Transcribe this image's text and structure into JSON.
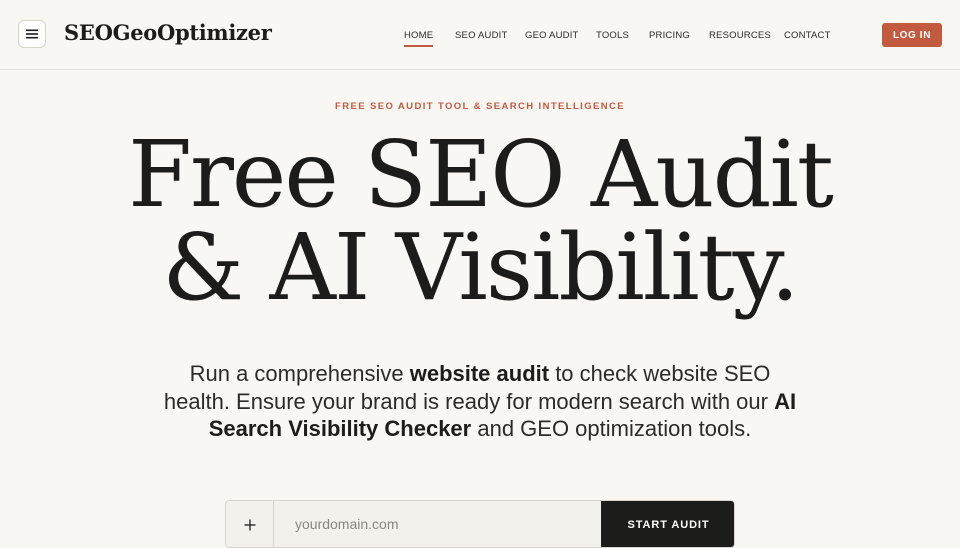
{
  "header": {
    "logo": "SEOGeoOptimizer",
    "menu_icon": "hamburger-menu-icon",
    "nav": [
      {
        "label": "HOME",
        "active": true
      },
      {
        "label": "SEO AUDIT",
        "active": false
      },
      {
        "label": "GEO AUDIT",
        "active": false
      },
      {
        "label": "TOOLS",
        "active": false
      },
      {
        "label": "PRICING",
        "active": false
      },
      {
        "label": "RESOURCES",
        "active": false
      },
      {
        "label": "CONTACT",
        "active": false
      }
    ],
    "login_label": "LOG IN"
  },
  "hero": {
    "eyebrow": "FREE SEO AUDIT TOOL & SEARCH INTELLIGENCE",
    "headline_line1": "Free SEO Audit",
    "headline_line2": "& AI Visibility.",
    "sub_1": "Run a comprehensive ",
    "sub_2": "website audit",
    "sub_3": " to check website SEO health. Ensure your brand is ready for modern search with our ",
    "sub_4": "AI Search Visibility Checker",
    "sub_5": " and GEO optimization tools."
  },
  "search": {
    "plus_icon": "plus-icon",
    "placeholder": "yourdomain.com",
    "button_label": "START AUDIT"
  },
  "colors": {
    "accent": "#c25a3f",
    "background": "#f9f7f3",
    "text": "#1c1c1a",
    "button_dark": "#1c1c1a"
  }
}
